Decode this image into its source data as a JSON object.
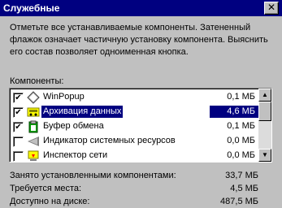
{
  "window": {
    "title": "Служебные",
    "close_glyph": "✕"
  },
  "description": "Отметьте все устанавливаемые компоненты. Затененный\nфлажок означает частичную установку компонента. Выяснить\nего состав позволяет одноименная кнопка.",
  "list_label": "Компоненты:",
  "components": [
    {
      "name": "WinPopup",
      "size": "0,1 МБ",
      "checked": true,
      "icon": "winpopup-icon"
    },
    {
      "name": "Архивация данных",
      "size": "4,6 МБ",
      "checked": true,
      "selected": true,
      "icon": "backup-icon"
    },
    {
      "name": "Буфер обмена",
      "size": "0,1 МБ",
      "checked": true,
      "icon": "clipboard-icon"
    },
    {
      "name": "Индикатор системных ресурсов",
      "size": "0,0 МБ",
      "checked": false,
      "icon": "resource-meter-icon"
    },
    {
      "name": "Инспектор сети",
      "size": "0,0 МБ",
      "checked": false,
      "icon": "net-watcher-icon"
    }
  ],
  "stats": [
    {
      "label": "Занято установленными компонентами:",
      "value": "33,7 МБ"
    },
    {
      "label": "Требуется места:",
      "value": "4,5 МБ"
    },
    {
      "label": "Доступно на диске:",
      "value": "487,5 МБ"
    }
  ],
  "check_glyph": "✔",
  "scrollbar": {
    "up": "▲",
    "down": "▼"
  }
}
